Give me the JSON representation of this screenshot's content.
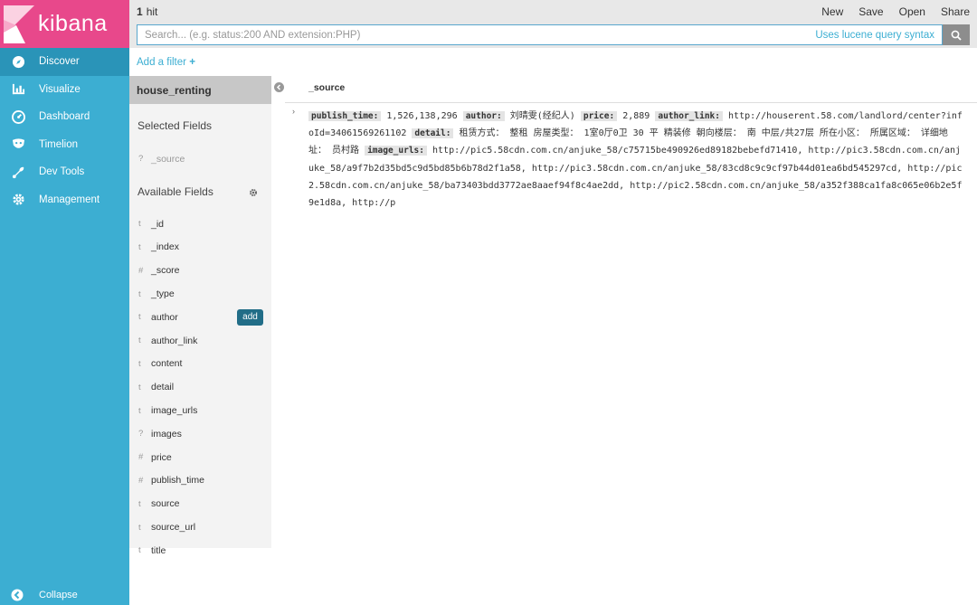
{
  "app": {
    "logo_text": "kibana"
  },
  "nav": {
    "items": [
      {
        "label": "Discover",
        "icon": "compass-icon",
        "active": true
      },
      {
        "label": "Visualize",
        "icon": "bar-chart-icon",
        "active": false
      },
      {
        "label": "Dashboard",
        "icon": "dashboard-icon",
        "active": false
      },
      {
        "label": "Timelion",
        "icon": "timelion-icon",
        "active": false
      },
      {
        "label": "Dev Tools",
        "icon": "wrench-icon",
        "active": false
      },
      {
        "label": "Management",
        "icon": "gear-icon",
        "active": false
      }
    ],
    "collapse_label": "Collapse"
  },
  "topbar": {
    "hits_count": "1",
    "hits_label": "hit",
    "actions": [
      "New",
      "Save",
      "Open",
      "Share"
    ]
  },
  "search": {
    "placeholder": "Search... (e.g. status:200 AND extension:PHP)",
    "syntax_link": "Uses lucene query syntax"
  },
  "filter": {
    "add_label": "Add a filter"
  },
  "sidebar": {
    "index_pattern": "house_renting",
    "selected_title": "Selected Fields",
    "selected_fields": [
      {
        "type": "?",
        "name": "_source"
      }
    ],
    "available_title": "Available Fields",
    "available_fields": [
      {
        "type": "t",
        "name": "_id"
      },
      {
        "type": "t",
        "name": "_index"
      },
      {
        "type": "#",
        "name": "_score"
      },
      {
        "type": "t",
        "name": "_type"
      },
      {
        "type": "t",
        "name": "author"
      },
      {
        "type": "t",
        "name": "author_link"
      },
      {
        "type": "t",
        "name": "content"
      },
      {
        "type": "t",
        "name": "detail"
      },
      {
        "type": "t",
        "name": "image_urls"
      },
      {
        "type": "?",
        "name": "images"
      },
      {
        "type": "#",
        "name": "price"
      },
      {
        "type": "#",
        "name": "publish_time"
      },
      {
        "type": "t",
        "name": "source"
      },
      {
        "type": "t",
        "name": "source_url"
      },
      {
        "type": "t",
        "name": "title"
      }
    ],
    "add_button_label": "add"
  },
  "document": {
    "column_header": "_source",
    "fields": [
      {
        "key": "publish_time:",
        "value": "1,526,138,296"
      },
      {
        "key": "author:",
        "value": "刘晴雯(经纪人)"
      },
      {
        "key": "price:",
        "value": "2,889"
      },
      {
        "key": "author_link:",
        "value": "http://houserent.58.com/landlord/center?infoId=34061569261102"
      },
      {
        "key": "detail:",
        "value": "租赁方式： 整租 房屋类型： 1室0厅0卫  30 平  精装修 朝向楼层： 南  中层/共27层 所在小区： 所属区域： 详细地址： 员村路"
      },
      {
        "key": "image_urls:",
        "value": "http://pic5.58cdn.com.cn/anjuke_58/c75715be490926ed89182bebefd71410, http://pic3.58cdn.com.cn/anjuke_58/a9f7b2d35bd5c9d5bd85b6b78d2f1a58, http://pic3.58cdn.com.cn/anjuke_58/83cd8c9c9cf97b44d01ea6bd545297cd, http://pic2.58cdn.com.cn/anjuke_58/ba73403bdd3772ae8aaef94f8c4ae2dd, http://pic2.58cdn.com.cn/anjuke_58/a352f388ca1fa8c065e06b2e5f9e1d8a, http://p"
      }
    ]
  },
  "colors": {
    "nav_bg": "#3caed2",
    "nav_active": "#2a94b8",
    "logo_bg": "#e8488b",
    "accent": "#3caed2",
    "add_button": "#216d87"
  }
}
